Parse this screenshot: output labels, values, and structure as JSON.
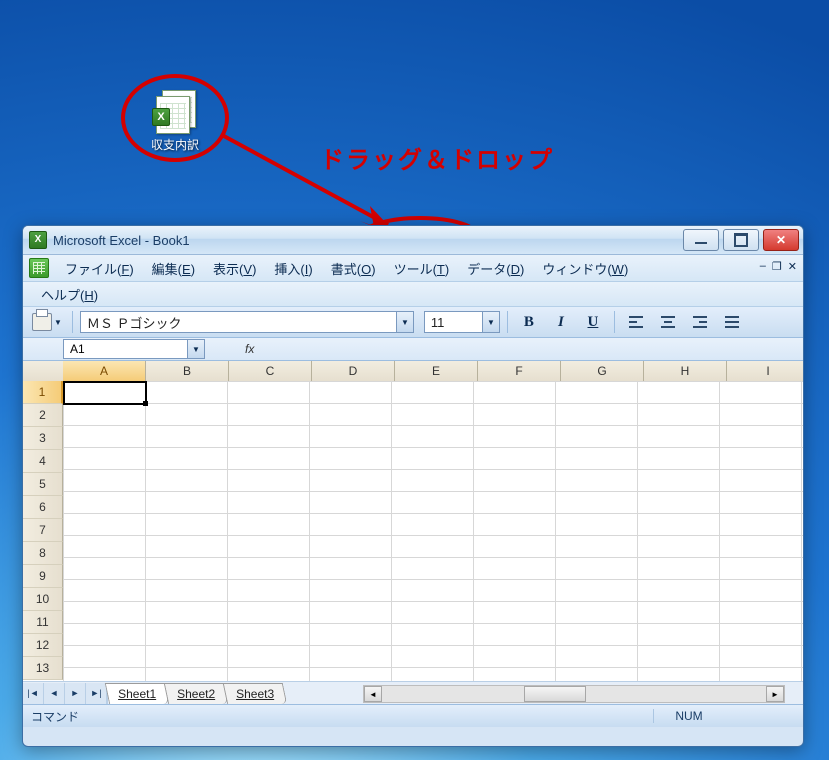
{
  "desktop": {
    "icon_label": "収支内訳"
  },
  "annotation": {
    "text": "ドラッグ＆ドロップ"
  },
  "window": {
    "title": "Microsoft Excel - Book1"
  },
  "menu": {
    "file": {
      "label": "ファイル",
      "accel": "F"
    },
    "edit": {
      "label": "編集",
      "accel": "E"
    },
    "view": {
      "label": "表示",
      "accel": "V"
    },
    "insert": {
      "label": "挿入",
      "accel": "I"
    },
    "format": {
      "label": "書式",
      "accel": "O"
    },
    "tools": {
      "label": "ツール",
      "accel": "T"
    },
    "data": {
      "label": "データ",
      "accel": "D"
    },
    "window": {
      "label": "ウィンドウ",
      "accel": "W"
    },
    "help": {
      "label": "ヘルプ",
      "accel": "H"
    }
  },
  "toolbar": {
    "font_name": "ＭＳ Ｐゴシック",
    "font_size": "11",
    "bold": "B",
    "italic": "I",
    "underline": "U"
  },
  "formula": {
    "name_box": "A1",
    "fx_label": "fx"
  },
  "grid": {
    "columns": [
      "A",
      "B",
      "C",
      "D",
      "E",
      "F",
      "G",
      "H",
      "I"
    ],
    "rows": [
      "1",
      "2",
      "3",
      "4",
      "5",
      "6",
      "7",
      "8",
      "9",
      "10",
      "11",
      "12",
      "13"
    ],
    "selected_col": "A",
    "selected_row": "1"
  },
  "tabs": {
    "sheets": [
      "Sheet1",
      "Sheet2",
      "Sheet3"
    ],
    "active": "Sheet1"
  },
  "status": {
    "left": "コマンド",
    "num": "NUM"
  }
}
